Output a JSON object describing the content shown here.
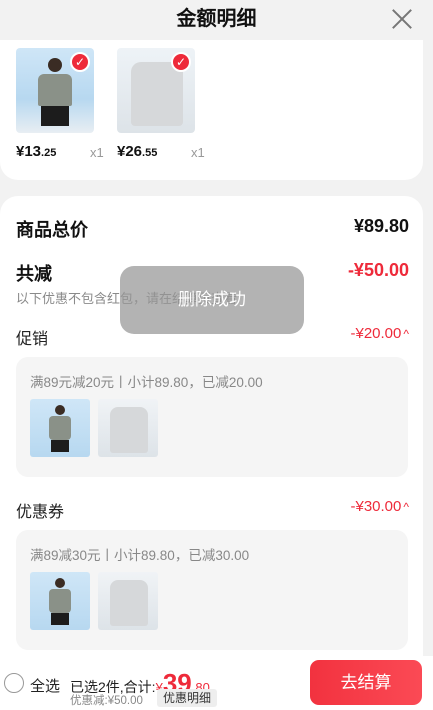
{
  "header": {
    "title": "金额明细"
  },
  "items": [
    {
      "price_int": "¥13",
      "price_dec": ".25",
      "qty": "x1"
    },
    {
      "price_int": "¥26",
      "price_dec": ".55",
      "qty": "x1"
    }
  ],
  "summary": {
    "total_label": "商品总价",
    "total_value": "¥89.80",
    "discount_label": "共减",
    "discount_value": "-¥50.00",
    "discount_note": "以下优惠不包含红包，请在结算页查看",
    "promo": {
      "label": "促销",
      "value": "-¥20.00",
      "chevron": "^",
      "desc": "满89元减20元丨小计89.80，已减20.00"
    },
    "coupon": {
      "label": "优惠券",
      "value": "-¥30.00",
      "chevron": "^",
      "desc": "满89减30元丨小计89.80，已减30.00"
    }
  },
  "toast": {
    "text": "删除成功"
  },
  "footer": {
    "select_all": "全选",
    "selected_text": "已选2件,合计:",
    "yen": "¥",
    "total_int": "39",
    "total_dec": ".80",
    "saved": "优惠减:¥50.00",
    "detail_btn": "优惠明细",
    "checkout_btn": "去结算"
  },
  "colors": {
    "accent": "#ee2a3a",
    "background": "#f2f2f2"
  }
}
